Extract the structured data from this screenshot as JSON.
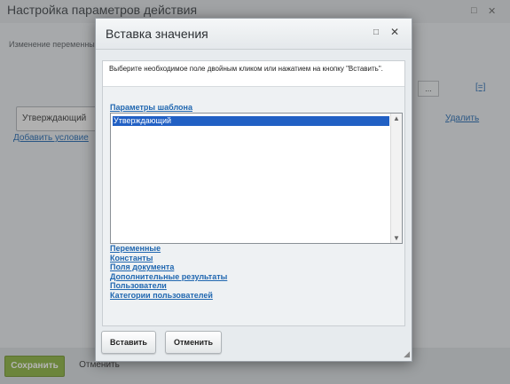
{
  "background": {
    "title": "Настройка параметров действия",
    "subtitle": "Изменение переменных",
    "field_value": "Утверждающий",
    "add_condition_link": "Добавить условие",
    "delete_link": "Удалить",
    "dots_button": "...",
    "formula_link": "[=]",
    "save_button": "Сохранить",
    "cancel_button": "Отменить",
    "maximize_icon": "□",
    "close_icon": "✕"
  },
  "dialog": {
    "title": "Вставка значения",
    "maximize_icon": "□",
    "close_icon": "✕",
    "hint": "Выберите необходимое поле двойным кликом или нажатием на кнопку \"Вставить\".",
    "template_params_link": "Параметры шаблона",
    "list": {
      "selected_item": "Утверждающий"
    },
    "links": [
      "Переменные",
      "Константы",
      "Поля документа",
      "Дополнительные результаты",
      "Пользователи",
      "Категории пользователей"
    ],
    "insert_button": "Вставить",
    "cancel_button": "Отменить"
  },
  "colors": {
    "link": "#2067b0",
    "selection": "#2160c4",
    "save_button": "#8ab23d"
  }
}
